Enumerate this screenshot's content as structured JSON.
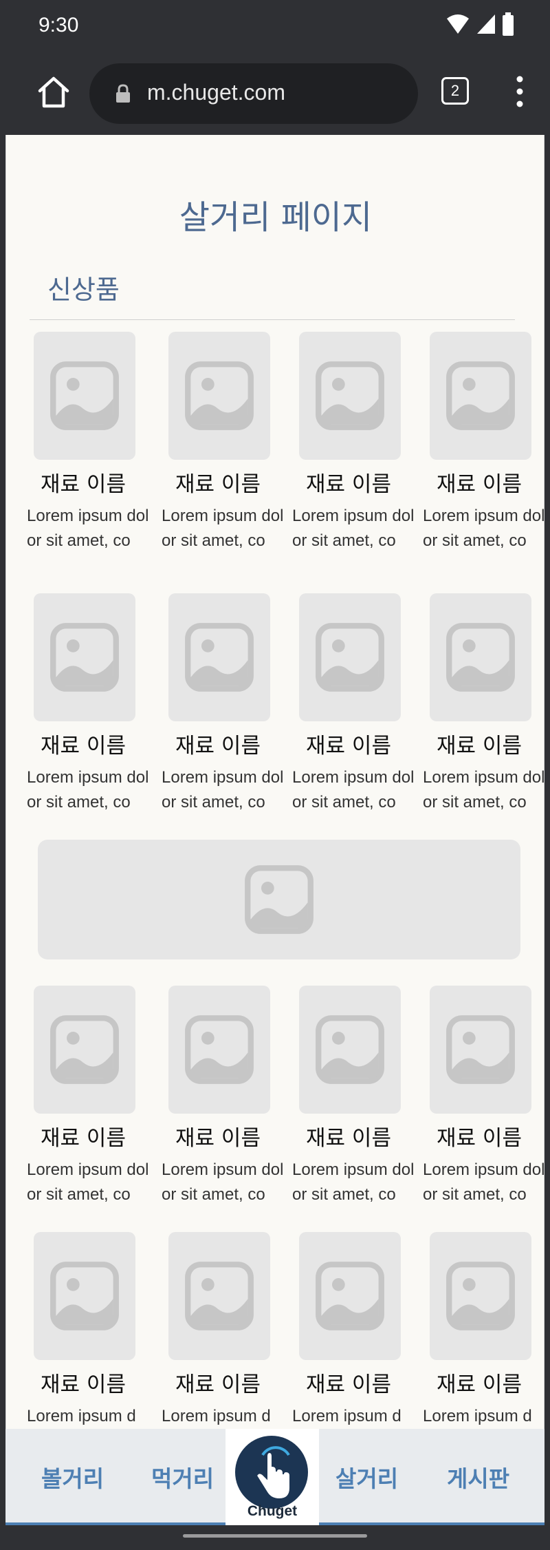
{
  "status_bar": {
    "time": "9:30"
  },
  "browser": {
    "url": "m.chuget.com",
    "tab_count": "2"
  },
  "page": {
    "title": "살거리 페이지",
    "section_title": "신상품",
    "items": [
      {
        "name": "재료 이름",
        "desc": "Lorem ipsum dolor sit amet, co"
      },
      {
        "name": "재료 이름",
        "desc": "Lorem ipsum dolor sit amet, co"
      },
      {
        "name": "재료 이름",
        "desc": "Lorem ipsum dolor sit amet, co"
      },
      {
        "name": "재료 이름",
        "desc": "Lorem ipsum dolor sit amet, co"
      },
      {
        "name": "재료 이름",
        "desc": "Lorem ipsum dolor sit amet, co"
      },
      {
        "name": "재료 이름",
        "desc": "Lorem ipsum dolor sit amet, co"
      },
      {
        "name": "재료 이름",
        "desc": "Lorem ipsum dolor sit amet, co"
      },
      {
        "name": "재료 이름",
        "desc": "Lorem ipsum dolor sit amet, co"
      },
      {
        "name": "재료 이름",
        "desc": "Lorem ipsum dolor sit amet, co"
      },
      {
        "name": "재료 이름",
        "desc": "Lorem ipsum dolor sit amet, co"
      },
      {
        "name": "재료 이름",
        "desc": "Lorem ipsum dolor sit amet, co"
      },
      {
        "name": "재료 이름",
        "desc": "Lorem ipsum dolor sit amet, co"
      },
      {
        "name": "재료 이름",
        "desc": "Lorem ipsum d"
      },
      {
        "name": "재료 이름",
        "desc": "Lorem ipsum d"
      },
      {
        "name": "재료 이름",
        "desc": "Lorem ipsum d"
      },
      {
        "name": "재료 이름",
        "desc": "Lorem ipsum d"
      }
    ]
  },
  "bottom_nav": {
    "items": [
      "볼거리",
      "먹거리",
      "살거리",
      "게시판"
    ],
    "logo_text": "Chuget"
  },
  "colors": {
    "accent": "#4d7fb3",
    "title": "#4d6990",
    "placeholder": "#e6e6e6",
    "page_bg": "#faf9f5"
  }
}
